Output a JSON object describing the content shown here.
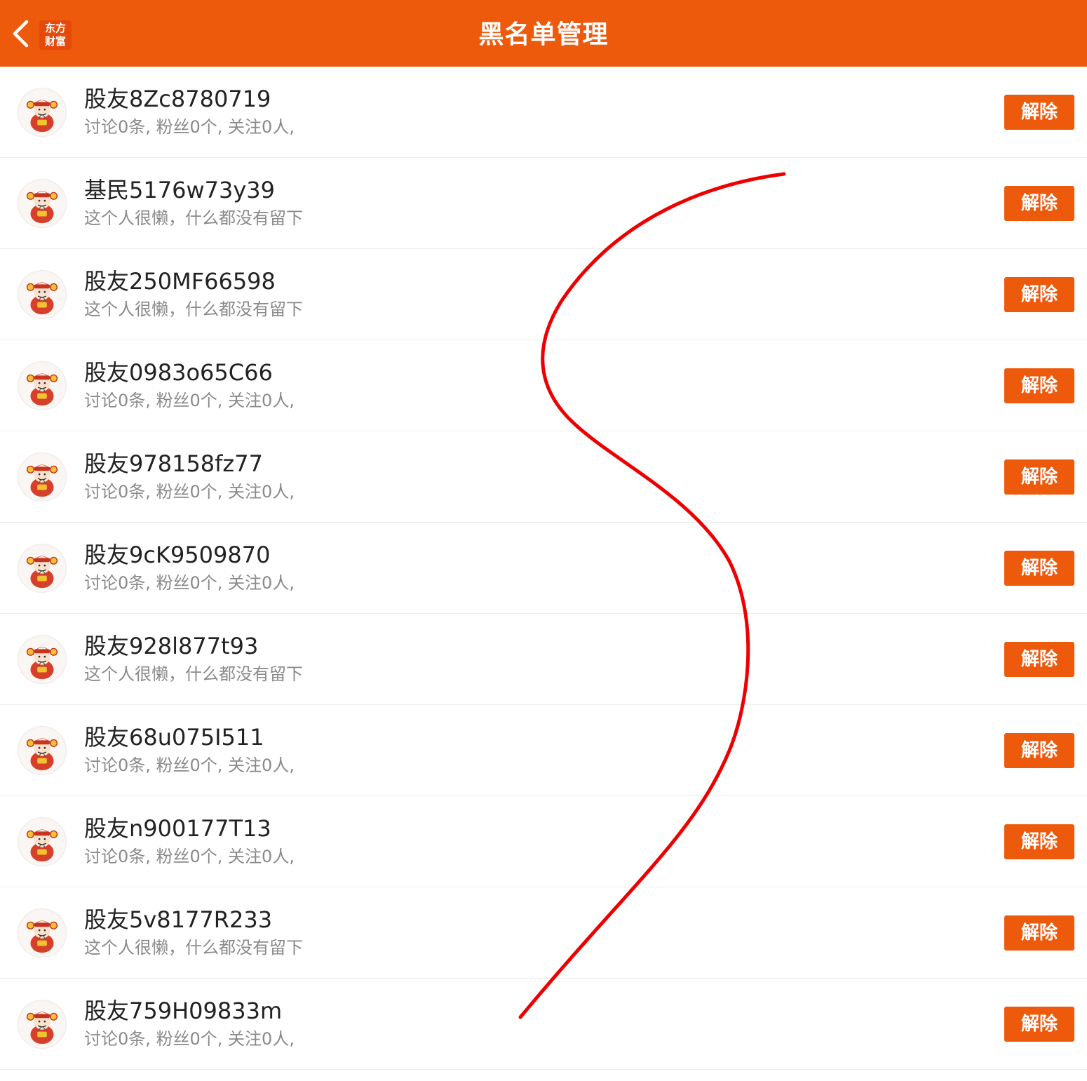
{
  "header": {
    "title": "黑名单管理",
    "logo_line1": "东方",
    "logo_line2": "财富",
    "back_icon": "chevron-left-icon",
    "background_color": "#ee5a0b"
  },
  "users": [
    {
      "name": "股友8Zc8780719",
      "desc": "讨论0条, 粉丝0个, 关注0人,",
      "action": "解除"
    },
    {
      "name": "基民5176w73y39",
      "desc": "这个人很懒，什么都没有留下",
      "action": "解除"
    },
    {
      "name": "股友250MF66598",
      "desc": "这个人很懒，什么都没有留下",
      "action": "解除"
    },
    {
      "name": "股友0983o65C66",
      "desc": "讨论0条, 粉丝0个, 关注0人,",
      "action": "解除"
    },
    {
      "name": "股友978158fz77",
      "desc": "讨论0条, 粉丝0个, 关注0人,",
      "action": "解除"
    },
    {
      "name": "股友9cK9509870",
      "desc": "讨论0条, 粉丝0个, 关注0人,",
      "action": "解除"
    },
    {
      "name": "股友928l877t93",
      "desc": "这个人很懒，什么都没有留下",
      "action": "解除"
    },
    {
      "name": "股友68u075I511",
      "desc": "讨论0条, 粉丝0个, 关注0人,",
      "action": "解除"
    },
    {
      "name": "股友n900177T13",
      "desc": "讨论0条, 粉丝0个, 关注0人,",
      "action": "解除"
    },
    {
      "name": "股友5v8177R233",
      "desc": "这个人很懒，什么都没有留下",
      "action": "解除"
    },
    {
      "name": "股友759H09833m",
      "desc": "讨论0条, 粉丝0个, 关注0人,",
      "action": "解除"
    }
  ],
  "avatar_icon": "god-of-wealth-avatar-icon",
  "annotation_color": "#ee0000",
  "accent_color": "#ee5a0b"
}
